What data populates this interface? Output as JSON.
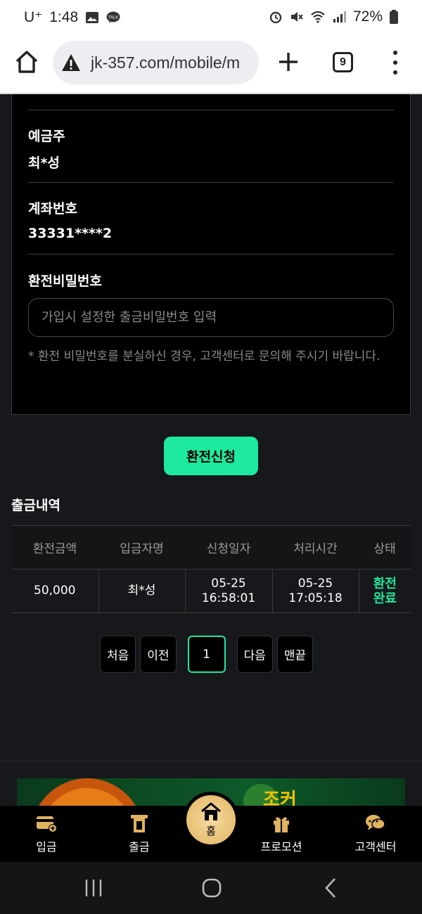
{
  "status_bar": {
    "carrier": "U⁺",
    "time": "1:48",
    "battery": "72%",
    "icons": [
      "gallery-icon",
      "talk-icon",
      "alarm-icon",
      "mute-icon",
      "wifi-icon",
      "signal-icon",
      "battery-icon"
    ]
  },
  "browser": {
    "url": "jk-357.com/mobile/m",
    "tab_count": "9"
  },
  "form": {
    "depositor_label": "예금주",
    "depositor_value": "최*성",
    "account_label": "계좌번호",
    "account_value": "33331****2",
    "password_label": "환전비밀번호",
    "password_placeholder": "가입시 설정한 출금비밀번호 입력",
    "notice": "* 환전 비밀번호를 분실하신 경우, 고객센터로 문의해 주시기 바랍니다.",
    "submit_label": "환전신청"
  },
  "history": {
    "title": "출금내역",
    "columns": [
      "환전금액",
      "입금자명",
      "신청일자",
      "처리시간",
      "상태"
    ],
    "rows": [
      {
        "amount": "50,000",
        "name": "최*성",
        "request_date": "05-25",
        "request_time": "16:58:01",
        "process_date": "05-25",
        "process_time": "17:05:18",
        "status_line1": "환전",
        "status_line2": "완료"
      }
    ]
  },
  "pager": {
    "first": "처음",
    "prev": "이전",
    "current": "1",
    "next": "다음",
    "last": "맨끝"
  },
  "banner": {
    "text": "조커"
  },
  "bottom_nav": {
    "deposit": "입금",
    "withdraw": "출금",
    "home": "홈",
    "promotion": "프로모션",
    "support": "고객센터"
  },
  "colors": {
    "accent": "#1de9a0",
    "background": "#17181b",
    "panel": "#000000",
    "gold": "#e0b360"
  }
}
